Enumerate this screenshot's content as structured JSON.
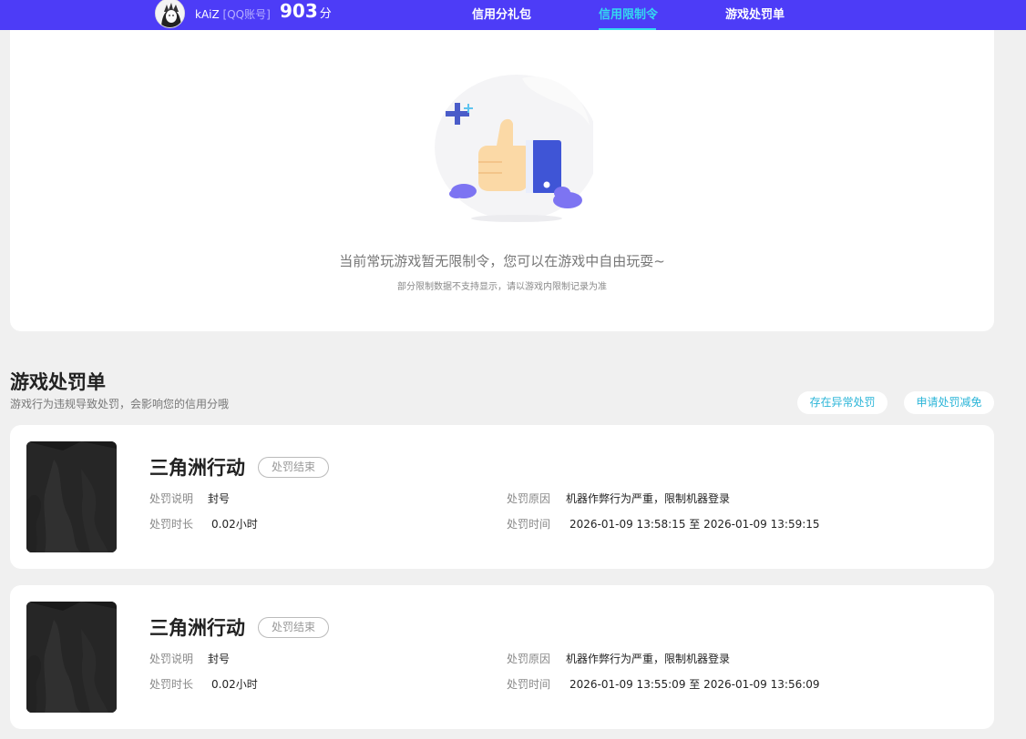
{
  "header": {
    "username": "kAiZ",
    "account_type": "[QQ账号]",
    "score": "903",
    "score_unit": "分",
    "tabs": [
      {
        "label": "信用分礼包",
        "active": false
      },
      {
        "label": "信用限制令",
        "active": true
      },
      {
        "label": "游戏处罚单",
        "active": false
      }
    ],
    "accent_color": "#4d3cf7",
    "active_tab_color": "#34d8f0"
  },
  "restriction": {
    "message": "当前常玩游戏暂无限制令，您可以在游戏中自由玩耍~",
    "note": "部分限制数据不支持显示，请以游戏内限制记录为准"
  },
  "penalty_section": {
    "title": "游戏处罚单",
    "description": "游戏行为违规导致处罚，会影响您的信用分哦",
    "buttons": {
      "abnormal": "存在异常处罚",
      "apply_reduction": "申请处罚减免"
    },
    "labels": {
      "desc": "处罚说明",
      "duration": "处罚时长",
      "reason": "处罚原因",
      "time": "处罚时间"
    },
    "items": [
      {
        "game": "三角洲行动",
        "status": "处罚结束",
        "desc": "封号",
        "duration": "0.02小时",
        "reason": "机器作弊行为严重，限制机器登录",
        "time": "2026-01-09 13:58:15 至 2026-01-09 13:59:15"
      },
      {
        "game": "三角洲行动",
        "status": "处罚结束",
        "desc": "封号",
        "duration": "0.02小时",
        "reason": "机器作弊行为严重，限制机器登录",
        "time": "2026-01-09 13:55:09 至 2026-01-09 13:56:09"
      }
    ]
  }
}
